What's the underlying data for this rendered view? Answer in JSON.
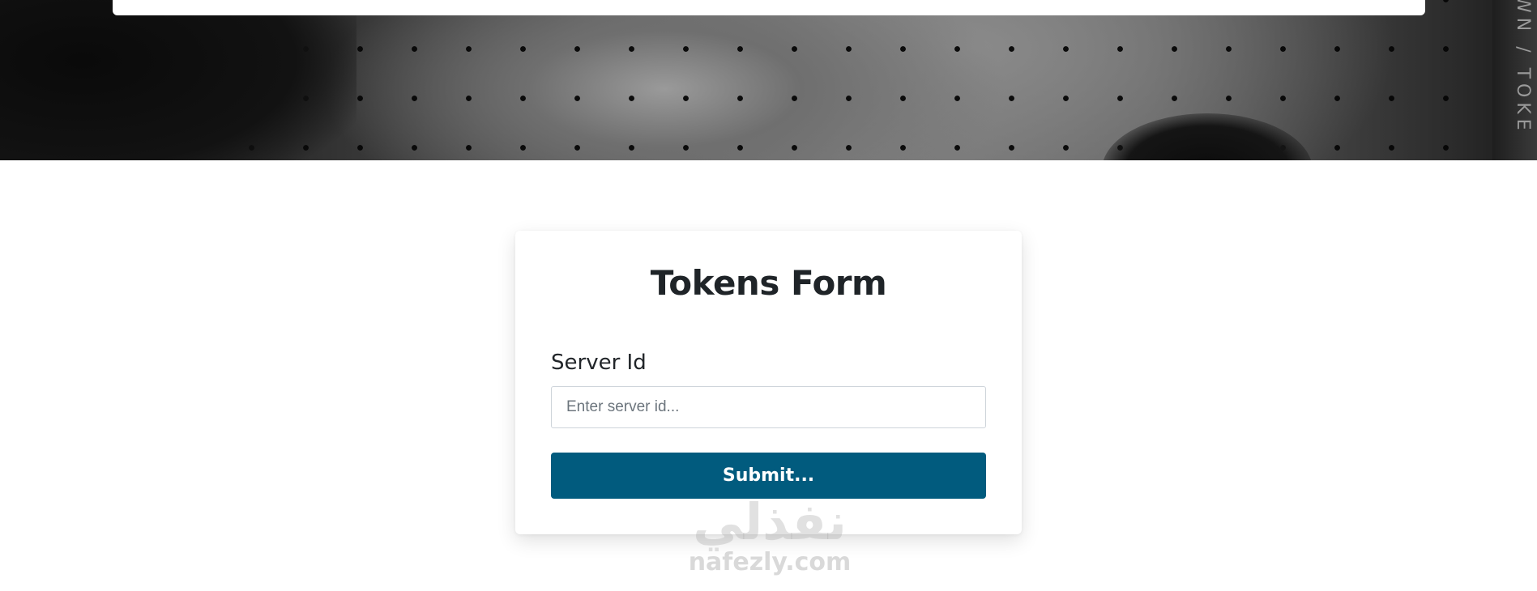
{
  "hero": {
    "vertical_text": "WN / TOKE"
  },
  "form": {
    "title": "Tokens Form",
    "server_id_label": "Server Id",
    "server_id_placeholder": "Enter server id...",
    "server_id_value": "",
    "submit_label": "Submit..."
  },
  "watermark": {
    "logo_text": "نفذلي",
    "url": "nafezly.com"
  },
  "colors": {
    "button_bg": "#015b7e",
    "button_text": "#ffffff",
    "title_text": "#1f2428"
  }
}
